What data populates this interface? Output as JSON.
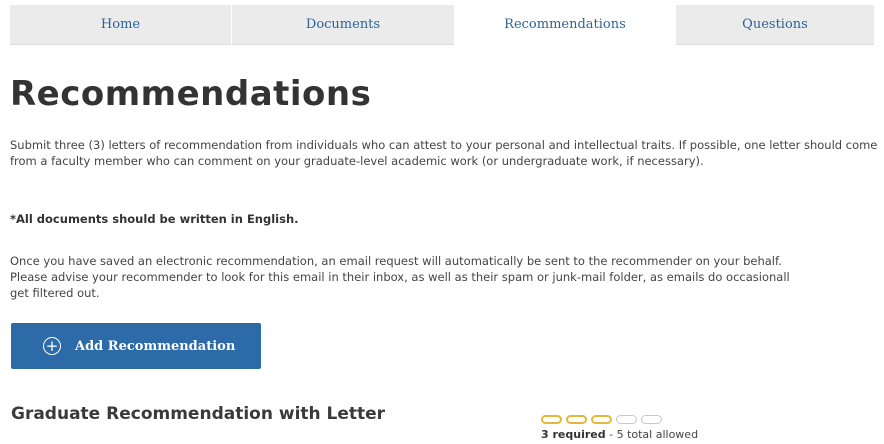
{
  "tabs": [
    {
      "label": "Home"
    },
    {
      "label": "Documents"
    },
    {
      "label": "Recommendations"
    },
    {
      "label": "Questions"
    }
  ],
  "active_tab": "Recommendations",
  "page": {
    "title": "Recommendations",
    "intro": "Submit three (3) letters of recommendation from individuals who can attest to your personal and intellectual traits. If possible, one letter should come from a faculty member who can comment on your graduate-level academic work (or undergraduate work, if necessary).",
    "note": "*All documents should be written in English.",
    "email_line1": "Once you have saved an electronic recommendation, an email request will automatically be sent to the recommender on your behalf.",
    "email_line2": "Please advise your recommender to look for this email in their inbox, as well as their spam or junk-mail folder, as emails do occasionall",
    "email_line3": "get filtered out."
  },
  "add_button": {
    "label": "Add Recommendation",
    "icon": "plus-circle-icon"
  },
  "section": {
    "title": "Graduate Recommendation with Letter",
    "required_label": "3 required",
    "allowed_label": " - 5 total allowed",
    "required": 3,
    "total_allowed": 5
  },
  "colors": {
    "tab_text": "#2a6398",
    "button_bg": "#2c6aa8",
    "pill_required": "#e2b93b",
    "pill_empty": "#c8c8c8"
  }
}
